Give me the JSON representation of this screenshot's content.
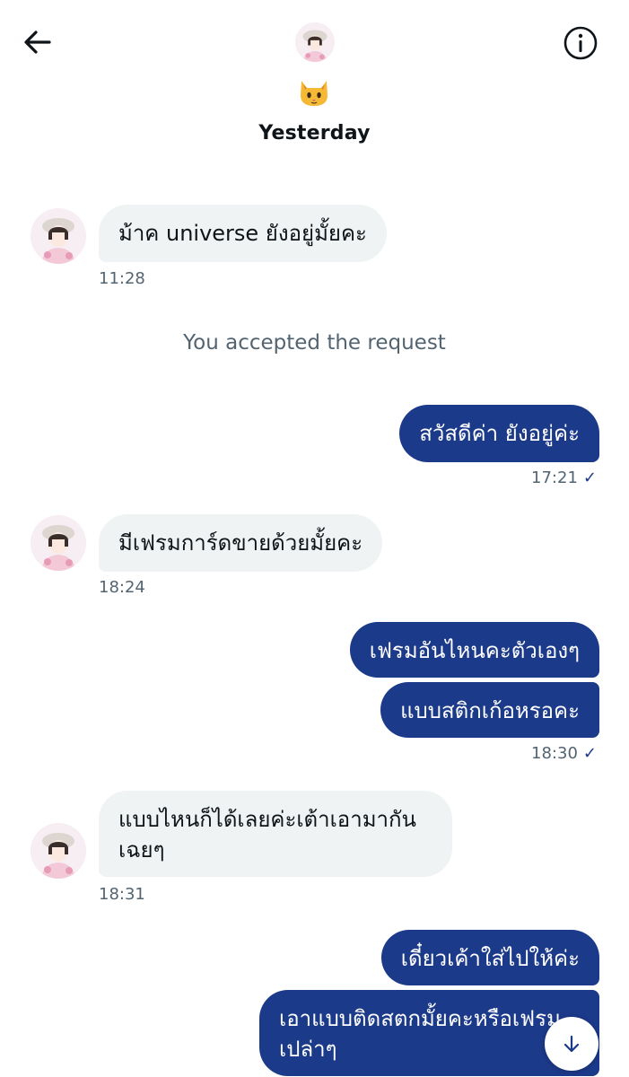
{
  "header": {
    "cat_emoji": "🐱",
    "day_label": "Yesterday",
    "back_icon": "arrow-left-icon",
    "info_icon": "info-circle-icon"
  },
  "messages": [
    {
      "dir": "in",
      "text": "ม้าค universe ยังอยู่มั้ยคะ",
      "time": "11:28"
    },
    {
      "dir": "system",
      "text": "You accepted the request"
    },
    {
      "dir": "out",
      "text": "สวัสดีค่า ยังอยู่ค่ะ",
      "time": "17:21"
    },
    {
      "dir": "in",
      "text": "มีเฟรมการ์ดขายด้วยมั้ยคะ",
      "time": "18:24"
    },
    {
      "dir": "out",
      "text": "เฟรมอันไหนคะตัวเองๆ"
    },
    {
      "dir": "out",
      "text": "แบบสติกเก้อหรอคะ",
      "time": "18:30"
    },
    {
      "dir": "in",
      "text": "แบบไหนก็ได้เลยค่ะเต้าเอามากันเฉยๆ",
      "time": "18:31"
    },
    {
      "dir": "out",
      "text": "เดี๋ยวเค้าใส่ไปให้ค่ะ"
    },
    {
      "dir": "out",
      "text": "เอาแบบติดสตกมั้ยคะหรือเฟรมเปล่าๆ"
    }
  ],
  "read_check": "✓",
  "colors": {
    "outgoing_bubble": "#1c3a8a",
    "incoming_bubble": "#eff3f4",
    "timestamp": "#536471"
  },
  "scroll_button_icon": "arrow-down-icon"
}
